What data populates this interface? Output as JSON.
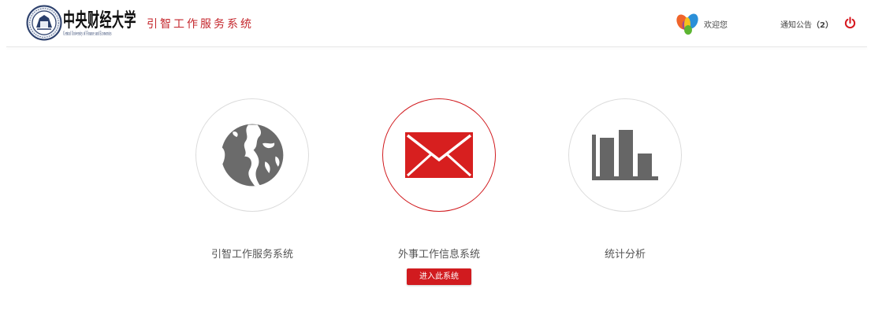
{
  "header": {
    "logo": {
      "name_cn": "中央财经大学",
      "name_en": "Central University of Finance and Economics",
      "icon": "university-emblem-icon"
    },
    "system_title": "引智工作服务系统",
    "user_icon": "butterfly-logo-icon",
    "welcome": "欢迎您",
    "notice": {
      "label": "通知公告",
      "count": "（2）"
    },
    "logout_icon": "power-icon"
  },
  "systems": [
    {
      "label": "引智工作服务系统",
      "icon": "globe-icon",
      "active": false
    },
    {
      "label": "外事工作信息系统",
      "icon": "envelope-icon",
      "active": true
    },
    {
      "label": "统计分析",
      "icon": "bar-chart-icon",
      "active": false
    }
  ],
  "enter_button": {
    "label": "进入此系统"
  },
  "colors": {
    "accent_red": "#d11b1f",
    "title_red": "#c4262c",
    "icon_gray": "#666666",
    "circle_border": "#dcdcdc",
    "text_gray": "#555555"
  }
}
